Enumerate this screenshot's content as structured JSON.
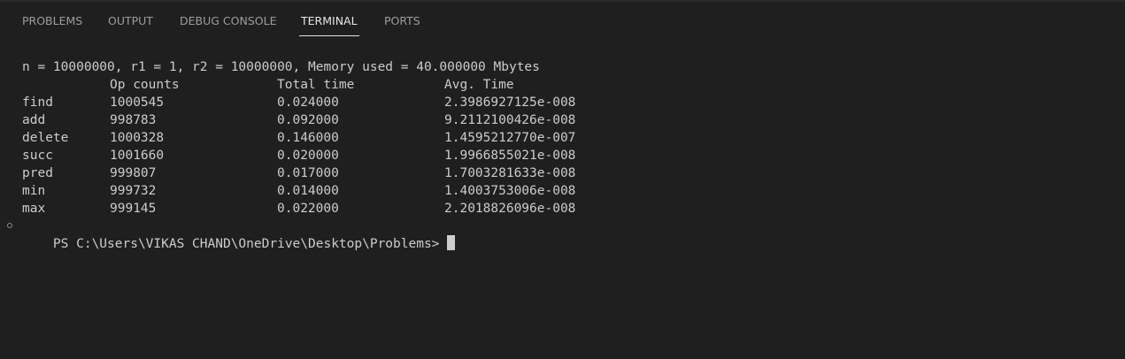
{
  "panel": {
    "tabs": [
      {
        "label": "PROBLEMS"
      },
      {
        "label": "OUTPUT"
      },
      {
        "label": "DEBUG CONSOLE"
      },
      {
        "label": "TERMINAL"
      },
      {
        "label": "PORTS"
      }
    ],
    "active_tab": "TERMINAL"
  },
  "terminal": {
    "summary": "n = 10000000, r1 = 1, r2 = 10000000, Memory used = 40.000000 Mbytes",
    "columns": [
      "",
      "Op counts",
      "Total time",
      "Avg. Time"
    ],
    "rows": [
      {
        "op": "find",
        "count": "1000545",
        "total": "0.024000",
        "avg": "2.3986927125e-008"
      },
      {
        "op": "add",
        "count": "998783",
        "total": "0.092000",
        "avg": "9.2112100426e-008"
      },
      {
        "op": "delete",
        "count": "1000328",
        "total": "0.146000",
        "avg": "1.4595212770e-007"
      },
      {
        "op": "succ",
        "count": "1001660",
        "total": "0.020000",
        "avg": "1.9966855021e-008"
      },
      {
        "op": "pred",
        "count": "999807",
        "total": "0.017000",
        "avg": "1.7003281633e-008"
      },
      {
        "op": "min",
        "count": "999732",
        "total": "0.014000",
        "avg": "1.4003753006e-008"
      },
      {
        "op": "max",
        "count": "999145",
        "total": "0.022000",
        "avg": "2.2018826096e-008"
      }
    ],
    "prompt": "PS C:\\Users\\VIKAS CHAND\\OneDrive\\Desktop\\Problems>"
  },
  "colors": {
    "background": "#1f1f1f",
    "text": "#cccccc",
    "tab_inactive": "#9d9d9d",
    "tab_active": "#e7e7e7"
  }
}
